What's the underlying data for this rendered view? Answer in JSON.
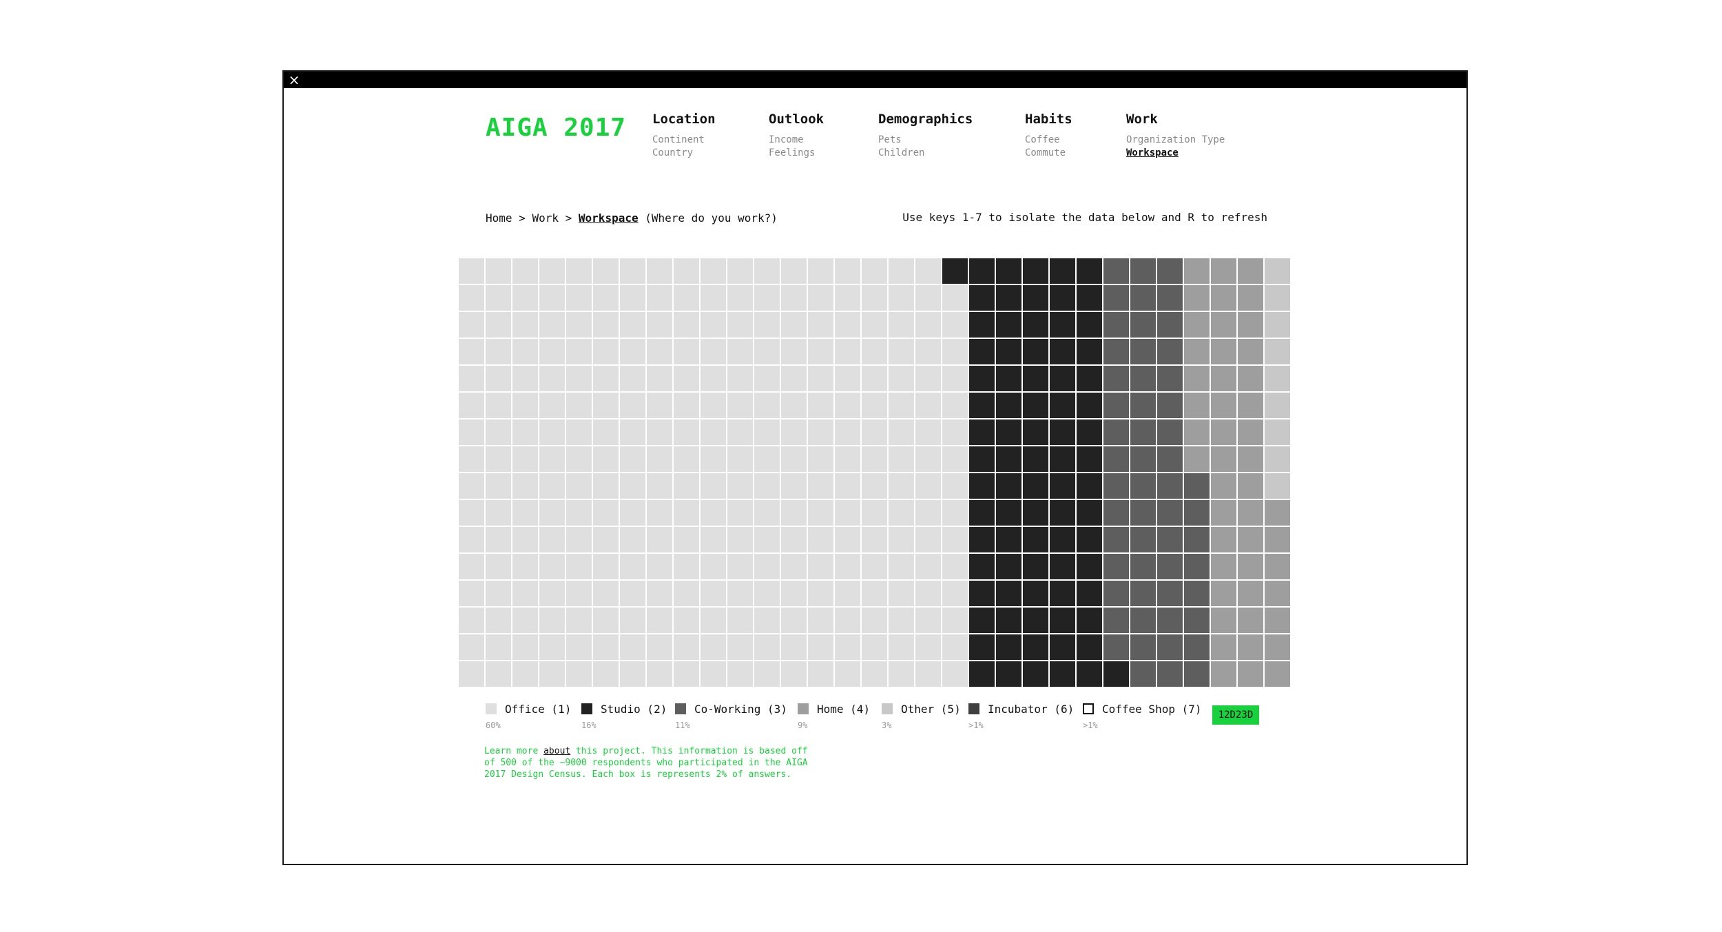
{
  "app": {
    "logo": "AIGA 2017",
    "close_icon": "×",
    "accent_color": "#19d13c"
  },
  "nav": [
    {
      "title": "Location",
      "items": [
        "Continent",
        "Country"
      ]
    },
    {
      "title": "Outlook",
      "items": [
        "Income",
        "Feelings"
      ]
    },
    {
      "title": "Demographics",
      "items": [
        "Pets",
        "Children"
      ]
    },
    {
      "title": "Habits",
      "items": [
        "Coffee",
        "Commute"
      ]
    },
    {
      "title": "Work",
      "items": [
        "Organization Type",
        "Workspace"
      ],
      "active_item": "Workspace"
    }
  ],
  "breadcrumb": {
    "home": "Home",
    "sep": ">",
    "section": "Work",
    "current": "Workspace",
    "question": "(Where do you work?)"
  },
  "hint": "Use keys 1-7 to isolate the data below and R to refresh",
  "chart_data": {
    "type": "waffle",
    "rows": 16,
    "columns": 31,
    "cells_per_category": [
      303,
      82,
      55,
      47,
      14,
      4,
      6
    ],
    "categories": [
      {
        "label": "Office (1)",
        "percent": "60%",
        "color": "#dfdfdf"
      },
      {
        "label": "Studio (2)",
        "percent": "16%",
        "color": "#222222"
      },
      {
        "label": "Co-Working (3)",
        "percent": "11%",
        "color": "#5e5e5e"
      },
      {
        "label": "Home (4)",
        "percent": "9%",
        "color": "#9e9e9e"
      },
      {
        "label": "Other (5)",
        "percent": "3%",
        "color": "#c8c8c8"
      },
      {
        "label": "Incubator (6)",
        "percent": ">1%",
        "color": "#3f3f3f"
      },
      {
        "label": "Coffee Shop (7)",
        "percent": ">1%",
        "color": "#f7f7f7"
      }
    ],
    "note": "Each box is represents 2% of answers."
  },
  "hex_button": "12D23D",
  "footnote": {
    "pre": "Learn more ",
    "link": "about",
    "post": " this project. This information is based off of 500 of the ~9000 respondents who participated in the AIGA 2017 Design Census. Each box is represents 2% of answers."
  }
}
